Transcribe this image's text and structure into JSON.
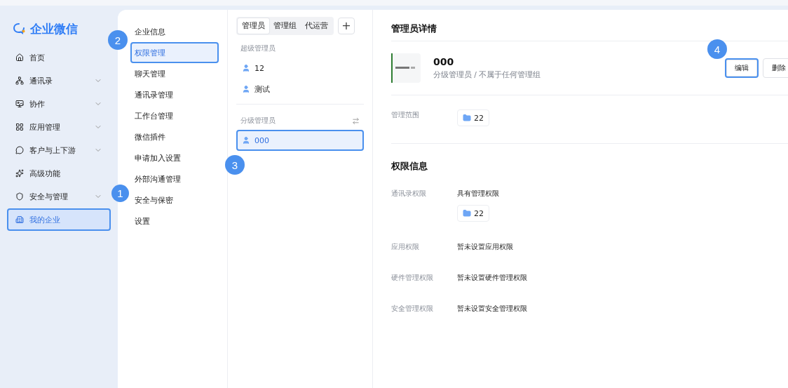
{
  "sidebar": {
    "logo": "企业微信",
    "items": [
      {
        "label": "首页",
        "expandable": false,
        "selected": false
      },
      {
        "label": "通讯录",
        "expandable": true,
        "selected": false
      },
      {
        "label": "协作",
        "expandable": true,
        "selected": false
      },
      {
        "label": "应用管理",
        "expandable": true,
        "selected": false
      },
      {
        "label": "客户与上下游",
        "expandable": true,
        "selected": false
      },
      {
        "label": "高级功能",
        "expandable": false,
        "selected": false
      },
      {
        "label": "安全与管理",
        "expandable": true,
        "selected": false
      },
      {
        "label": "我的企业",
        "expandable": false,
        "selected": true,
        "callout": "1"
      }
    ]
  },
  "submenu": {
    "items": [
      {
        "label": "企业信息",
        "selected": false
      },
      {
        "label": "权限管理",
        "selected": true,
        "callout": "2"
      },
      {
        "label": "聊天管理",
        "selected": false
      },
      {
        "label": "通讯录管理",
        "selected": false
      },
      {
        "label": "工作台管理",
        "selected": false
      },
      {
        "label": "微信插件",
        "selected": false
      },
      {
        "label": "申请加入设置",
        "selected": false
      },
      {
        "label": "外部沟通管理",
        "selected": false
      },
      {
        "label": "安全与保密",
        "selected": false
      },
      {
        "label": "设置",
        "selected": false
      }
    ]
  },
  "admin_list": {
    "tabs": [
      {
        "label": "管理员",
        "selected": true
      },
      {
        "label": "管理组",
        "selected": false
      },
      {
        "label": "代运营",
        "selected": false
      }
    ],
    "add_button": "+",
    "sections": [
      {
        "title": "超级管理员",
        "sortable": false,
        "admins": [
          {
            "name": "12",
            "selected": false
          },
          {
            "name": "测试",
            "selected": false
          }
        ]
      },
      {
        "title": "分级管理员",
        "sortable": true,
        "admins": [
          {
            "name": "000",
            "selected": true,
            "callout": "3"
          }
        ]
      }
    ]
  },
  "detail": {
    "title": "管理员详情",
    "admin": {
      "name": "000",
      "subtitle": "分级管理员 / 不属于任何管理组"
    },
    "buttons": [
      {
        "label": "编辑",
        "focused": true,
        "callout": "4"
      },
      {
        "label": "删除",
        "focused": false
      }
    ],
    "scope": {
      "label": "管理范围",
      "folder": "22"
    },
    "permissions": {
      "title": "权限信息",
      "rows": [
        {
          "label": "通讯录权限",
          "value": "具有管理权限",
          "folder": "22"
        },
        {
          "label": "应用权限",
          "value": "暂未设置应用权限"
        },
        {
          "label": "硬件管理权限",
          "value": "暂未设置硬件管理权限"
        },
        {
          "label": "安全管理权限",
          "value": "暂未设置安全管理权限"
        }
      ]
    }
  }
}
